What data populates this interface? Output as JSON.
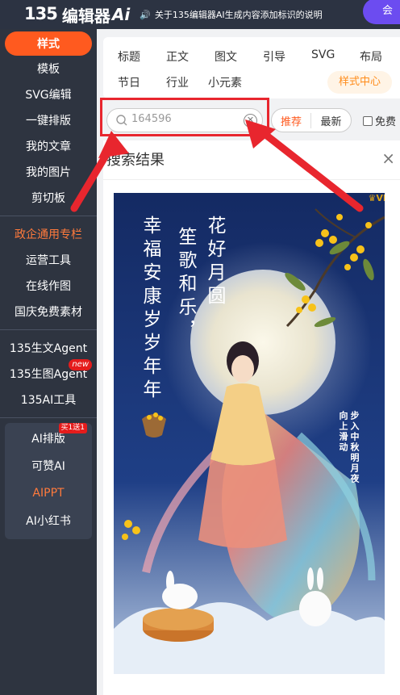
{
  "topbar": {
    "logo_mark": "135",
    "logo_text": "编辑器",
    "logo_ai": "Ai",
    "notice": "关于135编辑器AI生成内容添加标识的说明",
    "member_label": "会"
  },
  "sidebar": {
    "items": [
      {
        "label": "样式"
      },
      {
        "label": "模板"
      },
      {
        "label": "SVG编辑"
      },
      {
        "label": "一键排版"
      },
      {
        "label": "我的文章"
      },
      {
        "label": "我的图片"
      },
      {
        "label": "剪切板"
      }
    ],
    "group2": [
      {
        "label": "政企通用专栏"
      },
      {
        "label": "运营工具"
      },
      {
        "label": "在线作图"
      },
      {
        "label": "国庆免费素材"
      }
    ],
    "group3": [
      {
        "label": "135生文Agent"
      },
      {
        "label": "135生图Agent",
        "badge": "new"
      },
      {
        "label": "135AI工具"
      }
    ],
    "ai_group": [
      {
        "label": "AI排版",
        "badge": "买1送1"
      },
      {
        "label": "可赞AI"
      },
      {
        "label": "AIPPT"
      },
      {
        "label": "AI小红书"
      }
    ]
  },
  "main": {
    "tabs_row1": [
      "标题",
      "正文",
      "图文",
      "引导",
      "SVG",
      "布局"
    ],
    "tabs_row2": [
      "节日",
      "行业",
      "小元素"
    ],
    "style_center": "样式中心",
    "search": {
      "value": "164596"
    },
    "sort": {
      "recommend": "推荐",
      "latest": "最新"
    },
    "free_label": "免费",
    "results_title": "搜索结果",
    "close_label": "×"
  },
  "poster": {
    "vip_label": "VIP",
    "col1": "花好月圆",
    "col2": "笙歌和乐，",
    "col3": "幸福安康岁岁年年",
    "side1": "步入中秋明月夜",
    "side2": "向上滑动"
  },
  "colors": {
    "accent": "#ff5a1f",
    "sidebar_bg": "#2e3440",
    "highlight": "#e8262e",
    "member": "#6c4cf0"
  }
}
